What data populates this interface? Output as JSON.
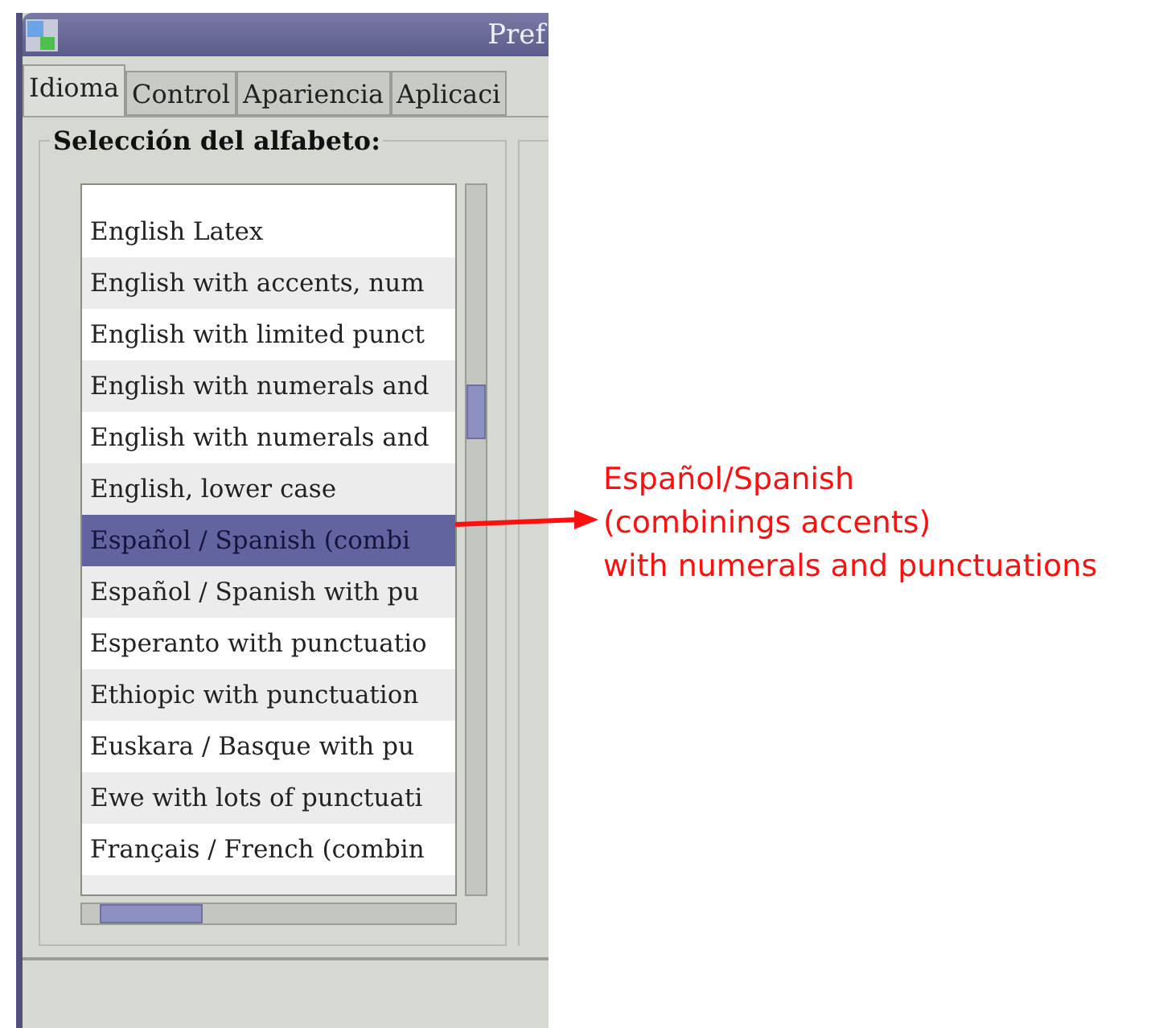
{
  "window": {
    "title": "Pref"
  },
  "tabs": [
    {
      "label": "Idioma",
      "selected": true
    },
    {
      "label": "Control",
      "selected": false
    },
    {
      "label": "Apariencia",
      "selected": false
    },
    {
      "label": "Aplicaci",
      "selected": false
    }
  ],
  "alphabet_group": {
    "label": "Selección del alfabeto:",
    "items": [
      {
        "label": "English Latex",
        "selected": false
      },
      {
        "label": "English with accents, num",
        "selected": false
      },
      {
        "label": "English with limited punct",
        "selected": false
      },
      {
        "label": "English with numerals and",
        "selected": false
      },
      {
        "label": "English with numerals and",
        "selected": false
      },
      {
        "label": "English, lower case",
        "selected": false
      },
      {
        "label": "Español / Spanish  (combi",
        "selected": true
      },
      {
        "label": "Español / Spanish with pu",
        "selected": false
      },
      {
        "label": "Esperanto with punctuatio",
        "selected": false
      },
      {
        "label": "Ethiopic with punctuation",
        "selected": false
      },
      {
        "label": "Euskara / Basque with pu",
        "selected": false
      },
      {
        "label": "Ewe with lots of punctuati",
        "selected": false
      },
      {
        "label": "Français / French (combin",
        "selected": false
      }
    ]
  },
  "annotation": {
    "lines": [
      "Español/Spanish",
      "(combinings accents)",
      "with numerals and punctuations"
    ]
  }
}
